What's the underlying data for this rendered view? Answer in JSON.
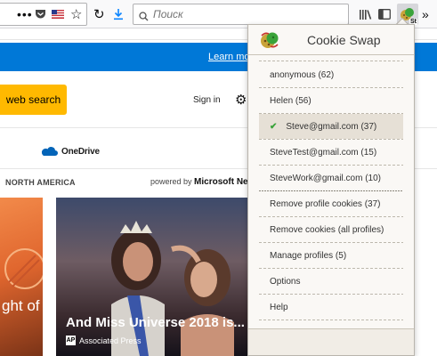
{
  "toolbar": {
    "search_placeholder": "Поиск",
    "ext_badge": "St"
  },
  "page": {
    "learn_more": "Learn more",
    "web_search": "web search",
    "sign_in": "Sign in",
    "onedrive": "OneDrive",
    "section": "NORTH AMERICA",
    "powered_by": "powered by",
    "powered_brand": "Microsoft News",
    "left_card_text": "ght of",
    "right_card_title": "And Miss Universe 2018 is...",
    "right_card_source_badge": "AP",
    "right_card_source": "Associated Press"
  },
  "popup": {
    "title": "Cookie Swap",
    "profiles": [
      {
        "label": "anonymous (62)",
        "selected": false
      },
      {
        "label": "Helen (56)",
        "selected": false
      },
      {
        "label": "Steve@gmail.com (37)",
        "selected": true
      },
      {
        "label": "SteveTest@gmail.com (15)",
        "selected": false
      },
      {
        "label": "SteveWork@gmail.com (10)",
        "selected": false
      }
    ],
    "actions": [
      {
        "label": "Remove profile cookies (37)"
      },
      {
        "label": "Remove cookies (all profiles)"
      },
      {
        "label": "Manage profiles (5)"
      },
      {
        "label": "Options"
      },
      {
        "label": "Help"
      }
    ]
  },
  "colors": {
    "accent_blue": "#0078d7",
    "search_button": "#ffb900",
    "check_green": "#3aa33a"
  }
}
